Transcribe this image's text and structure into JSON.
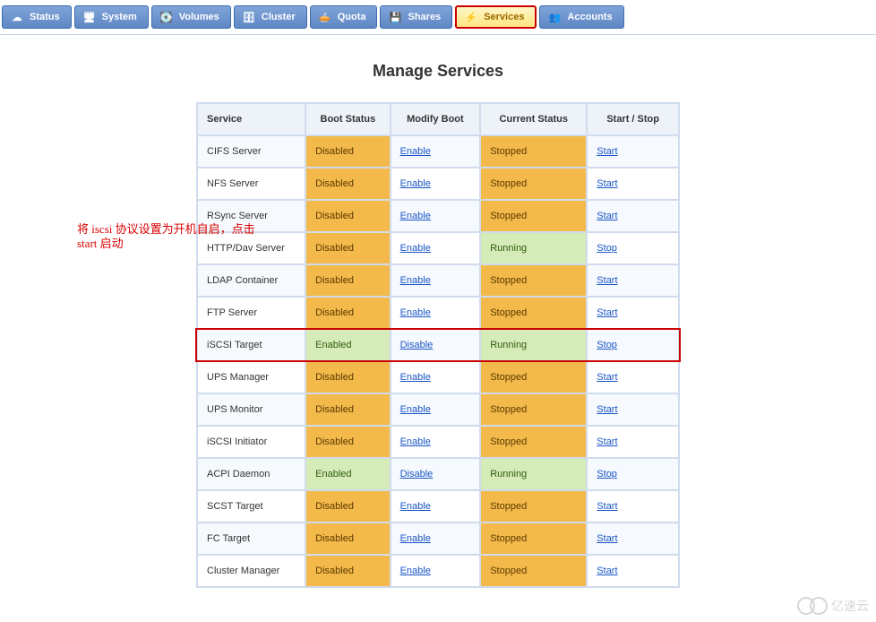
{
  "nav": {
    "tabs": [
      {
        "id": "status",
        "label": "Status"
      },
      {
        "id": "system",
        "label": "System"
      },
      {
        "id": "volumes",
        "label": "Volumes"
      },
      {
        "id": "cluster",
        "label": "Cluster"
      },
      {
        "id": "quota",
        "label": "Quota"
      },
      {
        "id": "shares",
        "label": "Shares"
      },
      {
        "id": "services",
        "label": "Services"
      },
      {
        "id": "accounts",
        "label": "Accounts"
      }
    ],
    "active": "services"
  },
  "page": {
    "title": "Manage Services"
  },
  "annotation": "将 iscsi 协议设置为开机自启，点击 start 启动",
  "table": {
    "headers": {
      "service": "Service",
      "boot": "Boot Status",
      "modify": "Modify Boot",
      "current": "Current Status",
      "action": "Start / Stop"
    },
    "boot_labels": {
      "enabled": "Enabled",
      "disabled": "Disabled"
    },
    "modify_labels": {
      "enable": "Enable",
      "disable": "Disable"
    },
    "status_labels": {
      "running": "Running",
      "stopped": "Stopped"
    },
    "action_labels": {
      "start": "Start",
      "stop": "Stop"
    },
    "rows": [
      {
        "name": "CIFS Server",
        "boot": "disabled",
        "modify": "enable",
        "status": "stopped",
        "action": "start"
      },
      {
        "name": "NFS Server",
        "boot": "disabled",
        "modify": "enable",
        "status": "stopped",
        "action": "start"
      },
      {
        "name": "RSync Server",
        "boot": "disabled",
        "modify": "enable",
        "status": "stopped",
        "action": "start"
      },
      {
        "name": "HTTP/Dav Server",
        "boot": "disabled",
        "modify": "enable",
        "status": "running",
        "action": "stop"
      },
      {
        "name": "LDAP Container",
        "boot": "disabled",
        "modify": "enable",
        "status": "stopped",
        "action": "start"
      },
      {
        "name": "FTP Server",
        "boot": "disabled",
        "modify": "enable",
        "status": "stopped",
        "action": "start"
      },
      {
        "name": "iSCSI Target",
        "boot": "enabled",
        "modify": "disable",
        "status": "running",
        "action": "stop",
        "highlight": true
      },
      {
        "name": "UPS Manager",
        "boot": "disabled",
        "modify": "enable",
        "status": "stopped",
        "action": "start"
      },
      {
        "name": "UPS Monitor",
        "boot": "disabled",
        "modify": "enable",
        "status": "stopped",
        "action": "start"
      },
      {
        "name": "iSCSI Initiator",
        "boot": "disabled",
        "modify": "enable",
        "status": "stopped",
        "action": "start"
      },
      {
        "name": "ACPI Daemon",
        "boot": "enabled",
        "modify": "disable",
        "status": "running",
        "action": "stop"
      },
      {
        "name": "SCST Target",
        "boot": "disabled",
        "modify": "enable",
        "status": "stopped",
        "action": "start"
      },
      {
        "name": "FC Target",
        "boot": "disabled",
        "modify": "enable",
        "status": "stopped",
        "action": "start"
      },
      {
        "name": "Cluster Manager",
        "boot": "disabled",
        "modify": "enable",
        "status": "stopped",
        "action": "start"
      }
    ]
  },
  "watermark": "亿速云",
  "icons": {
    "status": "☁",
    "system": "🖥",
    "volumes": "💽",
    "cluster": "🗄",
    "quota": "🥧",
    "shares": "💾",
    "services": "⚡",
    "accounts": "👥"
  }
}
